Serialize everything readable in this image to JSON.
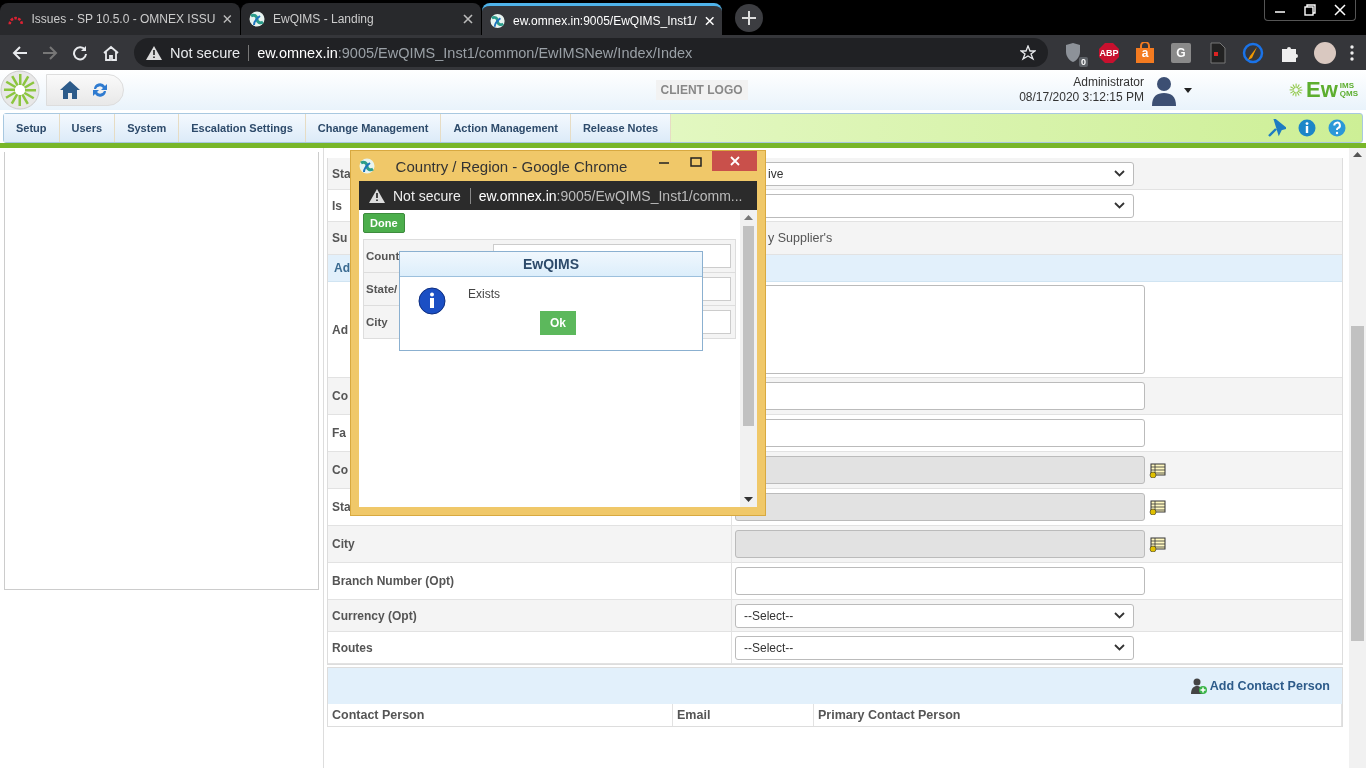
{
  "browser": {
    "tabs": [
      {
        "label": "Issues - SP 10.5.0 - OMNEX ISSU",
        "kind": "arc",
        "selected": false
      },
      {
        "label": "EwQIMS - Landing",
        "kind": "globe",
        "selected": false
      },
      {
        "label": "ew.omnex.in:9005/EwQIMS_Inst1/",
        "kind": "globe",
        "selected": true
      }
    ],
    "security": "Not secure",
    "url_host": "ew.omnex.in",
    "url_path": ":9005/EwQIMS_Inst1/common/EwIMSNew/Index/Index",
    "extensions": [
      {
        "kind": "shield",
        "label": "0"
      },
      {
        "kind": "abp",
        "label": "ABP"
      },
      {
        "kind": "bag",
        "label": "a"
      },
      {
        "kind": "g",
        "label": "G"
      },
      {
        "kind": "doc"
      },
      {
        "kind": "brush"
      },
      {
        "kind": "puzzle"
      }
    ]
  },
  "header": {
    "client_logo": "CLIENT LOGO",
    "user": "Administrator",
    "datetime": "08/17/2020 3:12:15 PM",
    "brand": "Ew",
    "brand_top": "IMS",
    "brand_bottom": "QMS"
  },
  "menu": [
    "Setup",
    "Users",
    "System",
    "Escalation Settings",
    "Change Management",
    "Action Management",
    "Release Notes"
  ],
  "form": {
    "rows": [
      {
        "kind": "select",
        "label": "Sta",
        "value": "ive"
      },
      {
        "kind": "select",
        "label": "Is"
      },
      {
        "kind": "text",
        "label": "Su",
        "value": "y Supplier's"
      },
      {
        "kind": "section",
        "label": "Ad"
      },
      {
        "kind": "textarea",
        "label": "Ad"
      },
      {
        "kind": "input",
        "label": "Co"
      },
      {
        "kind": "input",
        "label": "Fa"
      },
      {
        "kind": "lookup",
        "label": "Co"
      },
      {
        "kind": "lookup",
        "label": "Sta"
      },
      {
        "kind": "lookup",
        "label": "City"
      },
      {
        "kind": "input",
        "label": "Branch Number (Opt)"
      },
      {
        "kind": "select",
        "label": "Currency (Opt)",
        "value": "--Select--"
      },
      {
        "kind": "select",
        "label": "Routes",
        "value": "--Select--"
      }
    ],
    "add_contact": "Add Contact Person",
    "contact_columns": [
      "Contact Person",
      "Email",
      "Primary Contact Person"
    ]
  },
  "popup": {
    "title": "Country / Region - Google Chrome",
    "security": "Not secure",
    "url_host": "ew.omnex.in",
    "url_path": ":9005/EwQIMS_Inst1/comm...",
    "done": "Done",
    "rows": [
      "Count",
      "State/",
      "City"
    ],
    "dialog": {
      "title": "EwQIMS",
      "message": "Exists",
      "button": "Ok"
    }
  }
}
